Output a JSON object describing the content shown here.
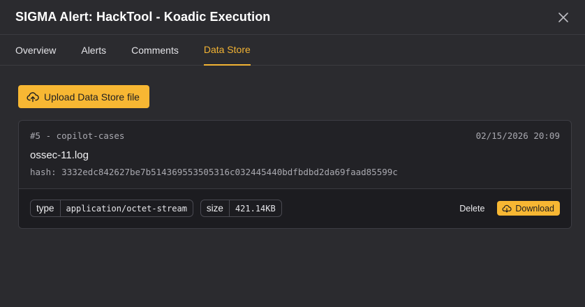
{
  "modal": {
    "title": "SIGMA Alert: HackTool - Koadic Execution"
  },
  "tabs": [
    {
      "label": "Overview",
      "active": false
    },
    {
      "label": "Alerts",
      "active": false
    },
    {
      "label": "Comments",
      "active": false
    },
    {
      "label": "Data Store",
      "active": true
    }
  ],
  "actions": {
    "upload_label": "Upload Data Store file"
  },
  "file": {
    "case_ref": "#5 - copilot-cases",
    "timestamp": "02/15/2026 20:09",
    "name": "ossec-11.log",
    "hash_label": "hash:",
    "hash_value": "3332edc842627be7b514369553505316c032445440bdfbdbd2da69faad85599c",
    "type_key": "type",
    "type_value": "application/octet-stream",
    "size_key": "size",
    "size_value": "421.14KB",
    "delete_label": "Delete",
    "download_label": "Download"
  },
  "colors": {
    "accent": "#f7b733",
    "background": "#2b2b2f",
    "card": "#222226"
  },
  "icons": {
    "close": "close-icon",
    "upload": "cloud-upload-icon",
    "download": "cloud-download-icon"
  }
}
